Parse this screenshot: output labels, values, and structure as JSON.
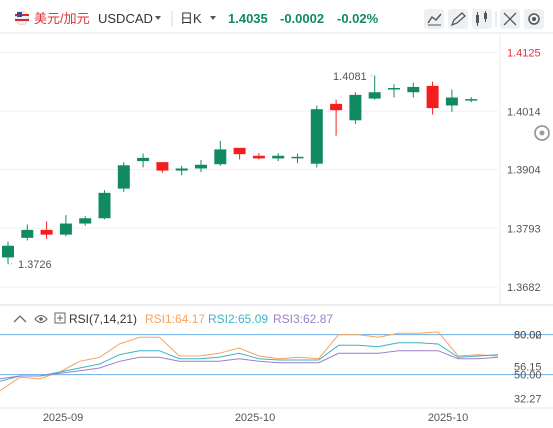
{
  "header": {
    "pair_name": "美元/加元",
    "symbol": "USDCAD",
    "period": "日K",
    "last_price": "1.4035",
    "change": "-0.0002",
    "change_pct": "-0.02%"
  },
  "toolbar": {
    "icons": [
      "line-chart-icon",
      "draw-pen-icon",
      "candlestick-icon",
      "expand-icon",
      "settings-icon"
    ]
  },
  "colors": {
    "up": "#118a64",
    "down": "#f51e1e",
    "price_change": "#118a64",
    "rsi1": "#f7a35c",
    "rsi2": "#3fb3c4",
    "rsi3": "#9b7fc9",
    "rsi_level": "#6aaee8",
    "last_price_axis": "#e0333a"
  },
  "rsi_panel": {
    "label": "RSI(7,14,21)",
    "rsi1_label": "RSI1:64.17",
    "rsi2_label": "RSI2:65.09",
    "rsi3_label": "RSI3:62.87"
  },
  "chart_data": [
    {
      "type": "candlestick",
      "ylim": [
        1.365,
        1.416
      ],
      "y_ticks": [
        "1.4125",
        "1.4014",
        "1.3904",
        "1.3793",
        "1.3682"
      ],
      "x_ticks": [
        "2025-09",
        "2025-10",
        "2025-10"
      ],
      "annotations": {
        "high": "1.4081",
        "low": "1.3726"
      },
      "candles": [
        {
          "o": 1.3738,
          "h": 1.3768,
          "l": 1.3726,
          "c": 1.376
        },
        {
          "o": 1.3775,
          "h": 1.38,
          "l": 1.377,
          "c": 1.379
        },
        {
          "o": 1.379,
          "h": 1.3806,
          "l": 1.3773,
          "c": 1.3781
        },
        {
          "o": 1.3781,
          "h": 1.3818,
          "l": 1.3778,
          "c": 1.3802
        },
        {
          "o": 1.3802,
          "h": 1.3816,
          "l": 1.3798,
          "c": 1.3812
        },
        {
          "o": 1.3812,
          "h": 1.3865,
          "l": 1.381,
          "c": 1.386
        },
        {
          "o": 1.3868,
          "h": 1.3918,
          "l": 1.3862,
          "c": 1.3912
        },
        {
          "o": 1.392,
          "h": 1.3934,
          "l": 1.3908,
          "c": 1.3926
        },
        {
          "o": 1.3918,
          "h": 1.3916,
          "l": 1.3898,
          "c": 1.3902
        },
        {
          "o": 1.3902,
          "h": 1.3911,
          "l": 1.3893,
          "c": 1.3906
        },
        {
          "o": 1.3906,
          "h": 1.3922,
          "l": 1.3899,
          "c": 1.3913
        },
        {
          "o": 1.3914,
          "h": 1.3958,
          "l": 1.3911,
          "c": 1.3942
        },
        {
          "o": 1.3945,
          "h": 1.3941,
          "l": 1.3923,
          "c": 1.3933
        },
        {
          "o": 1.393,
          "h": 1.3935,
          "l": 1.3923,
          "c": 1.3925
        },
        {
          "o": 1.3925,
          "h": 1.3935,
          "l": 1.392,
          "c": 1.393
        },
        {
          "o": 1.3928,
          "h": 1.3934,
          "l": 1.3916,
          "c": 1.3928
        },
        {
          "o": 1.3915,
          "h": 1.4025,
          "l": 1.3908,
          "c": 1.4018
        },
        {
          "o": 1.4028,
          "h": 1.4036,
          "l": 1.3968,
          "c": 1.4016
        },
        {
          "o": 1.3997,
          "h": 1.405,
          "l": 1.399,
          "c": 1.4045
        },
        {
          "o": 1.4038,
          "h": 1.4081,
          "l": 1.4036,
          "c": 1.405
        },
        {
          "o": 1.4058,
          "h": 1.4065,
          "l": 1.404,
          "c": 1.4058
        },
        {
          "o": 1.405,
          "h": 1.4068,
          "l": 1.404,
          "c": 1.406
        },
        {
          "o": 1.4062,
          "h": 1.407,
          "l": 1.4008,
          "c": 1.402
        },
        {
          "o": 1.4025,
          "h": 1.4055,
          "l": 1.4013,
          "c": 1.404
        },
        {
          "o": 1.4035,
          "h": 1.4041,
          "l": 1.4031,
          "c": 1.4037
        }
      ]
    },
    {
      "type": "line",
      "title": "RSI(7,14,21)",
      "ylim": [
        25,
        85
      ],
      "y_ticks": [
        "80.00",
        "80.02",
        "56.15",
        "50.00",
        "32.27"
      ],
      "reference_lines": [
        80,
        50
      ],
      "series": [
        {
          "name": "RSI1",
          "values": [
            38,
            48,
            47,
            52,
            60,
            63,
            73,
            78,
            78,
            64,
            64,
            66,
            70,
            64,
            62,
            63,
            62,
            80,
            80,
            78,
            81,
            81,
            82,
            64,
            65,
            64
          ]
        },
        {
          "name": "RSI2",
          "values": [
            45,
            49,
            49,
            52,
            55,
            58,
            65,
            68,
            68,
            62,
            62,
            63,
            66,
            62,
            61,
            61,
            61,
            72,
            72,
            71,
            74,
            74,
            73,
            63,
            64,
            65
          ]
        },
        {
          "name": "RSI3",
          "values": [
            47,
            49,
            49,
            51,
            53,
            55,
            60,
            63,
            63,
            60,
            60,
            60,
            62,
            60,
            59,
            59,
            59,
            66,
            66,
            66,
            68,
            68,
            68,
            62,
            62,
            63
          ]
        }
      ]
    }
  ]
}
